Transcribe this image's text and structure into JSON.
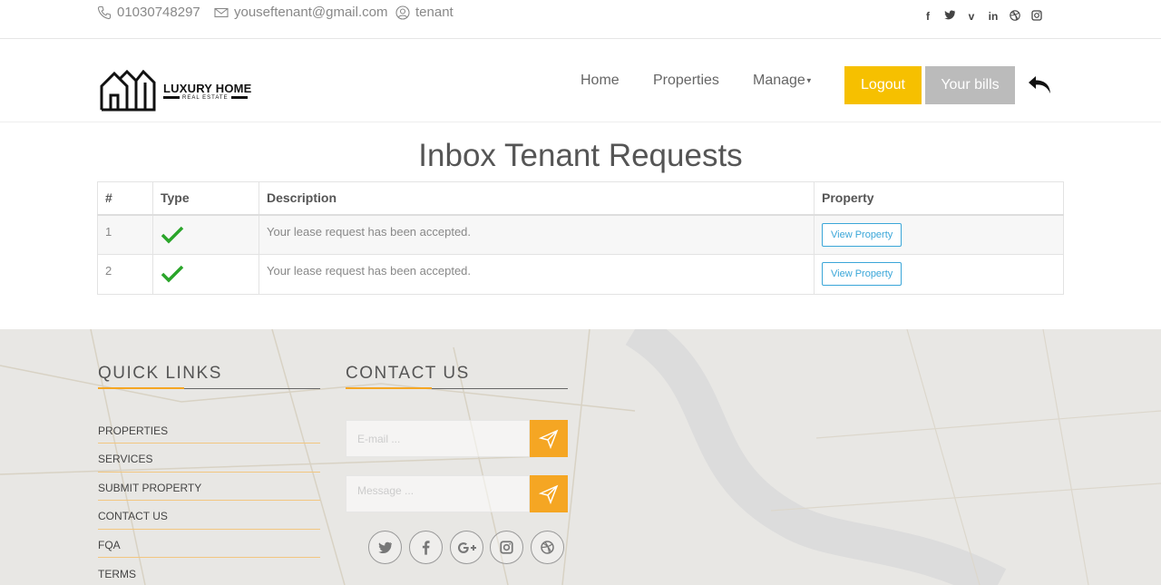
{
  "topbar": {
    "phone": "01030748297",
    "email": "youseftenant@gmail.com",
    "user": "tenant",
    "social": [
      "f",
      "t",
      "v",
      "in",
      "d",
      "ig"
    ]
  },
  "header": {
    "logo_title": "LUXURY HOME",
    "logo_sub": "REAL ESTATE",
    "nav": {
      "home": "Home",
      "properties": "Properties",
      "manage": "Manage"
    },
    "logout": "Logout",
    "bills": "Your bills"
  },
  "main": {
    "title": "Inbox Tenant Requests",
    "columns": [
      "#",
      "Type",
      "Description",
      "Property"
    ],
    "rows": [
      {
        "num": "1",
        "description": "Your lease request has been accepted.",
        "action": "View Property"
      },
      {
        "num": "2",
        "description": "Your lease request has been accepted.",
        "action": "View Property"
      }
    ]
  },
  "footer": {
    "quick_links_title": "QUICK LINKS",
    "contact_title": "CONTACT US",
    "links": [
      "PROPERTIES",
      "SERVICES",
      "SUBMIT PROPERTY",
      "CONTACT US",
      "FQA",
      "TERMS"
    ],
    "email_placeholder": "E-mail ...",
    "message_placeholder": "Message ...",
    "social_icons": [
      "twitter-icon",
      "facebook-icon",
      "google-plus-icon",
      "instagram-icon",
      "dribbble-icon"
    ]
  },
  "colors": {
    "accent": "#f6c000",
    "orange": "#f5a623",
    "link": "#3aa6d8",
    "check": "#2aa52a"
  }
}
